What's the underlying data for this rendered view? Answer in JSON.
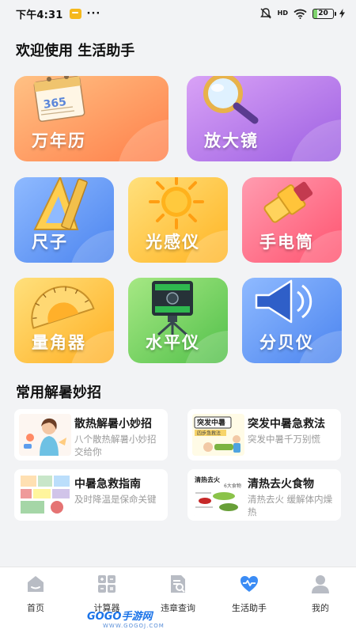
{
  "status_bar": {
    "time": "下午4:31",
    "network": "HD",
    "battery": "20"
  },
  "header": {
    "title": "欢迎使用 生活助手"
  },
  "tools": [
    {
      "label": "万年历",
      "icon": "calendar-icon",
      "color_from": "#ffb06a",
      "color_to": "#ff7a45"
    },
    {
      "label": "放大镜",
      "icon": "magnifier-icon",
      "color_from": "#c98bf0",
      "color_to": "#9b5de0"
    },
    {
      "label": "尺子",
      "icon": "ruler-icon",
      "color_from": "#7fb0ff",
      "color_to": "#4c86f0"
    },
    {
      "label": "光感仪",
      "icon": "sun-icon",
      "color_from": "#ffd35c",
      "color_to": "#ffb020"
    },
    {
      "label": "手电筒",
      "icon": "flashlight-icon",
      "color_from": "#ff8aa0",
      "color_to": "#ff5574"
    },
    {
      "label": "量角器",
      "icon": "protractor-icon",
      "color_from": "#ffd35c",
      "color_to": "#ffae1f"
    },
    {
      "label": "水平仪",
      "icon": "level-icon",
      "color_from": "#9ae07a",
      "color_to": "#55c24a"
    },
    {
      "label": "分贝仪",
      "icon": "speaker-icon",
      "color_from": "#7fb0ff",
      "color_to": "#4c86f0"
    }
  ],
  "tips_section": {
    "title": "常用解暑妙招",
    "items": [
      {
        "title": "散热解暑小妙招",
        "subtitle": "八个散热解暑小妙招交给你"
      },
      {
        "title": "突发中暑急救法",
        "subtitle": "突发中暑千万别慌"
      },
      {
        "title": "中暑急救指南",
        "subtitle": "及时降温是保命关键"
      },
      {
        "title": "清热去火食物",
        "subtitle": "清热去火 缓解体内燥热"
      }
    ],
    "thumb_text": {
      "first_aid_banner": "突发中暑",
      "first_aid_sub": "四步急救法",
      "food_banner": "清热去火",
      "food_sub": "6大食物"
    }
  },
  "tabbar": {
    "items": [
      {
        "label": "首页",
        "active": false
      },
      {
        "label": "计算器",
        "active": false
      },
      {
        "label": "违章查询",
        "active": false
      },
      {
        "label": "生活助手",
        "active": true
      },
      {
        "label": "我的",
        "active": false
      }
    ]
  },
  "watermark": {
    "brand": "GOGO手游网",
    "url": "WWW.GOGOJ.COM"
  },
  "colors": {
    "tab_active": "#3b8cf5",
    "tab_inactive": "#b8bcc4",
    "page_bg": "#f2f3f5"
  }
}
